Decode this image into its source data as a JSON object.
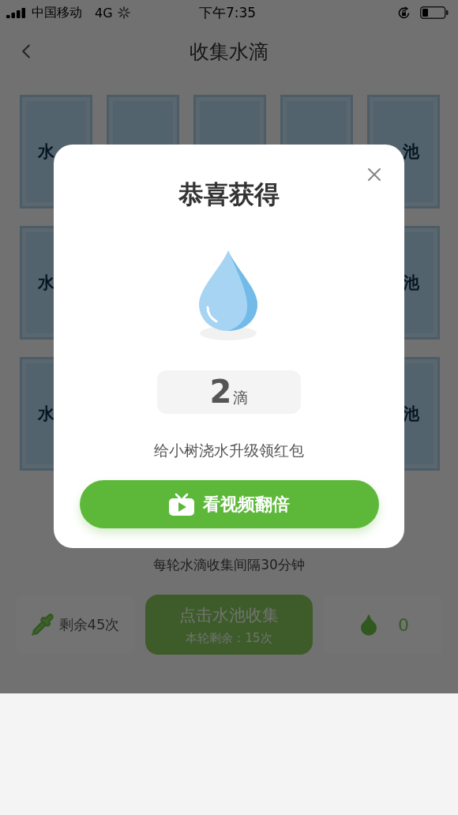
{
  "status_bar": {
    "carrier": "中国移动",
    "network": "4G",
    "time": "下午7:35"
  },
  "nav": {
    "title": "收集水滴"
  },
  "pool_rows": [
    {
      "left_label": "水",
      "right_label": "池"
    },
    {
      "left_label": "水",
      "right_label": "池"
    },
    {
      "left_label": "水",
      "right_label": "池"
    }
  ],
  "hint": "每轮水滴收集间隔30分钟",
  "bottom_bar": {
    "remaining": "剩余45次",
    "collect_label": "点击水池收集",
    "collect_sub": "本轮剩余：15次",
    "drops": "0"
  },
  "dialog": {
    "title": "恭喜获得",
    "amount": "2",
    "unit": "滴",
    "message": "给小树浇水升级领红包",
    "action": "看视频翻倍"
  }
}
